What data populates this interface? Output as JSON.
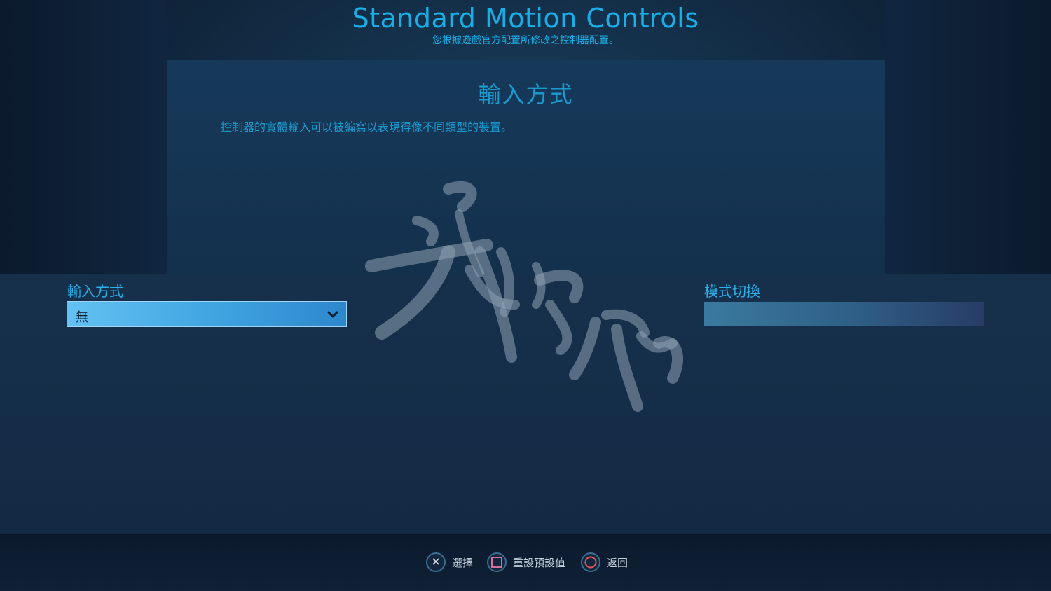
{
  "header": {
    "title": "Standard Motion Controls",
    "subtitle": "您根據遊戲官方配置所修改之控制器配置。"
  },
  "info_panel": {
    "heading": "輸入方式",
    "description": "控制器的實體輸入可以被編寫以表現得像不同類型的裝置。"
  },
  "input_method": {
    "label": "輸入方式",
    "selected_value": "無"
  },
  "mode_switch": {
    "label": "模式切換"
  },
  "footer": {
    "buttons": [
      {
        "icon": "cross-button-icon",
        "label": "選擇"
      },
      {
        "icon": "square-button-icon",
        "label": "重設預設值"
      },
      {
        "icon": "circle-button-icon",
        "label": "返回"
      }
    ]
  },
  "colors": {
    "accent": "#1aaee6",
    "dropdown": "#3fa3e0",
    "circle_button": "#e0555a",
    "square_button": "#e87aa6"
  }
}
